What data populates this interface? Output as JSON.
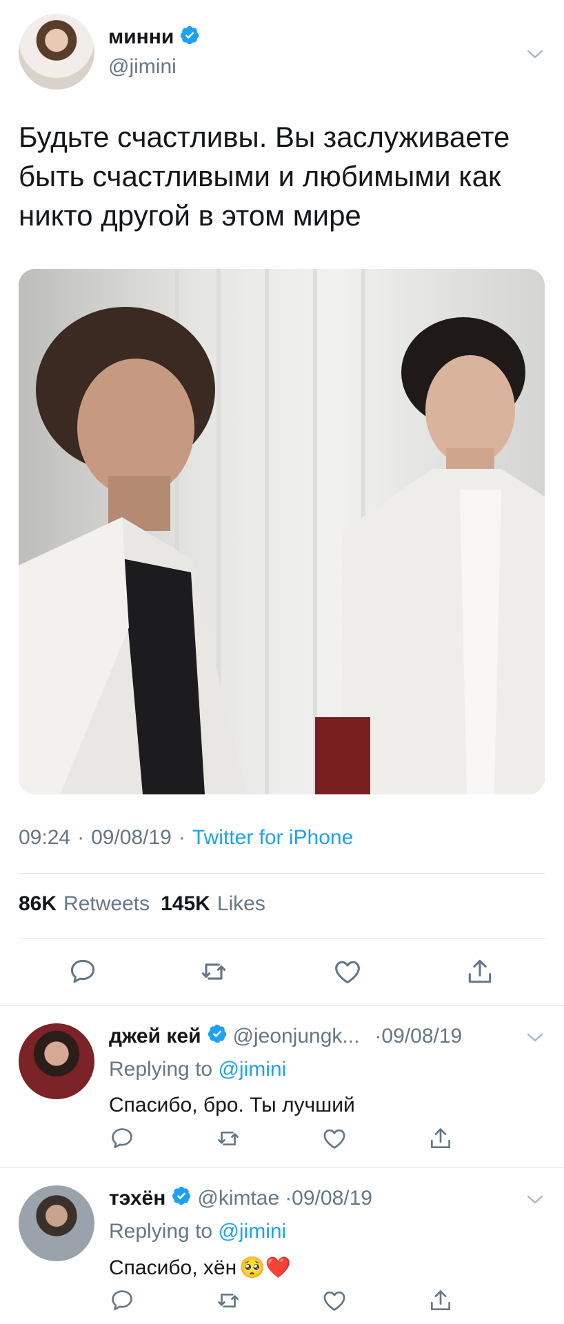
{
  "tweet": {
    "author_name": "минни",
    "author_handle": "@jimini",
    "text": "Будьте счастливы. Вы заслуживаете быть счастливыми и любимыми как никто другой в этом мире",
    "time": "09:24",
    "date": "09/08/19",
    "sep": "·",
    "source": "Twitter for iPhone",
    "retweets_count": "86K",
    "retweets_label": "Retweets",
    "likes_count": "145K",
    "likes_label": "Likes",
    "photo_icon": "photo-icon"
  },
  "replies": [
    {
      "name": "джей кей",
      "handle": "@jeonjungk...",
      "date": "·09/08/19",
      "replying_label": "Replying to",
      "replying_to": "@jimini",
      "text": "Спасибо, бро. Ты лучший",
      "emoji": ""
    },
    {
      "name": "тэхён",
      "handle": "@kimtae",
      "date": "·09/08/19",
      "replying_label": "Replying to",
      "replying_to": "@jimini",
      "text": "Спасибо, хён",
      "emoji": "🥺❤️"
    }
  ],
  "icons": {
    "reply": "reply-icon",
    "retweet": "retweet-icon",
    "like": "heart-icon",
    "share": "share-icon",
    "verified": "verified-badge-icon",
    "caret": "chevron-down-icon"
  },
  "colors": {
    "accent": "#1da1f2",
    "secondary_text": "#657786",
    "divider": "#e1e8ed"
  }
}
